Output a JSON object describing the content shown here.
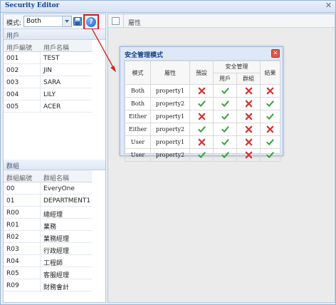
{
  "window": {
    "title": "Security Editor"
  },
  "toolbar": {
    "mode_label": "模式:",
    "mode_value": "Both"
  },
  "users": {
    "section_title": "用戶",
    "headers": [
      "用戶編號",
      "用戶名稱"
    ],
    "rows": [
      [
        "001",
        "TEST"
      ],
      [
        "002",
        "JIN"
      ],
      [
        "003",
        "SARA"
      ],
      [
        "004",
        "LILY"
      ],
      [
        "005",
        "ACER"
      ]
    ]
  },
  "groups": {
    "section_title": "群組",
    "headers": [
      "群組編號",
      "群組名稱"
    ],
    "rows": [
      [
        "00",
        "EveryOne"
      ],
      [
        "01",
        "DEPARTMENT1"
      ],
      [
        "R00",
        "總經理"
      ],
      [
        "R01",
        "業務"
      ],
      [
        "R02",
        "業務經理"
      ],
      [
        "R03",
        "行政經理"
      ],
      [
        "R04",
        "工程師"
      ],
      [
        "R05",
        "客服經理"
      ],
      [
        "R09",
        "財務會計"
      ]
    ]
  },
  "properties_panel": {
    "header": "屬性"
  },
  "dialog": {
    "title": "安全管理模式",
    "headers": {
      "mode": "模式",
      "property": "屬性",
      "default": "預設",
      "security": "安全管理",
      "user": "用戶",
      "group": "群組",
      "result": "結果"
    },
    "rows": [
      {
        "mode": "Both",
        "property": "property1",
        "default": false,
        "user": true,
        "group": false,
        "result": false
      },
      {
        "mode": "Both",
        "property": "property2",
        "default": true,
        "user": true,
        "group": false,
        "result": true
      },
      {
        "mode": "Either",
        "property": "property1",
        "default": false,
        "user": true,
        "group": false,
        "result": true
      },
      {
        "mode": "Either",
        "property": "property2",
        "default": true,
        "user": true,
        "group": false,
        "result": false
      },
      {
        "mode": "User",
        "property": "property1",
        "default": false,
        "user": true,
        "group": false,
        "result": true
      },
      {
        "mode": "User",
        "property": "property2",
        "default": true,
        "user": true,
        "group": false,
        "result": true
      }
    ]
  },
  "colors": {
    "check": "#3aa23a",
    "cross": "#d83030",
    "highlight": "#d81f1f",
    "title_blue": "#15428b"
  }
}
